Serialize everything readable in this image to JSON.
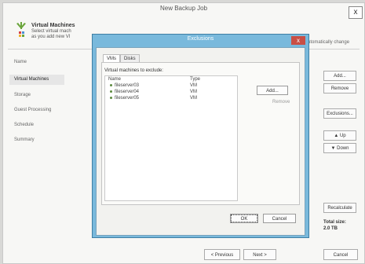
{
  "window": {
    "title": "New Backup Job",
    "close": "x",
    "header_title": "Virtual Machines",
    "header_sub1": "Select virtual mach",
    "header_sub2": "as you add new VI",
    "header_right": "utomatically change"
  },
  "nav": {
    "items": [
      "Name",
      "Virtual Machines",
      "Storage",
      "Guest Processing",
      "Schedule",
      "Summary"
    ],
    "active": "Virtual Machines"
  },
  "side_buttons": {
    "add": "Add...",
    "remove": "Remove",
    "exclusions": "Exclusions...",
    "up": "Up",
    "down": "Down",
    "recalculate": "Recalculate"
  },
  "total": {
    "label": "Total size:",
    "value": "2.0 TB"
  },
  "bottom": {
    "previous": "< Previous",
    "next": "Next >",
    "cancel": "Cancel"
  },
  "dialog": {
    "title": "Exclusions",
    "close": "x",
    "tabs": [
      "VMs",
      "Disks"
    ],
    "vm_label": "Virtual machines to exclude:",
    "columns": {
      "name": "Name",
      "type": "Type"
    },
    "rows": [
      {
        "name": "fileserver03",
        "type": "VM"
      },
      {
        "name": "fileserver04",
        "type": "VM"
      },
      {
        "name": "fileserver05",
        "type": "VM"
      }
    ],
    "add": "Add...",
    "remove": "Remove",
    "ok": "OK",
    "cancel": "Cancel"
  },
  "colors": {
    "dialog_frame": "#79b9dc",
    "close_red": "#c94f45",
    "vm_dot": "#5c8a3e"
  }
}
